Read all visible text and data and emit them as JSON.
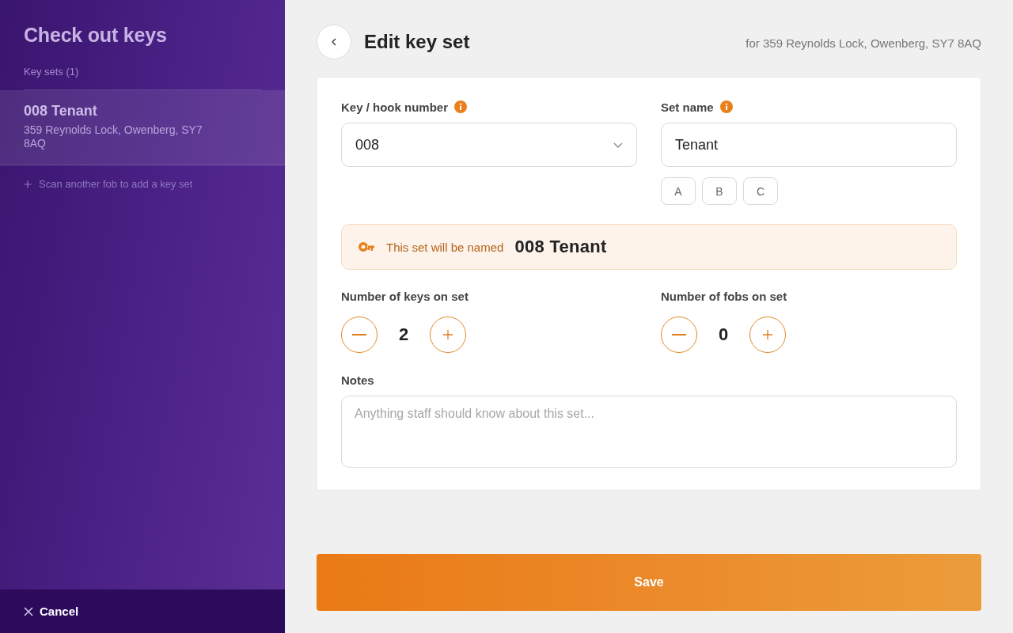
{
  "sidebar": {
    "title": "Check out keys",
    "section_label": "Key sets (1)",
    "key_sets": [
      {
        "name": "008 Tenant",
        "address": "359 Reynolds Lock, Owenberg, SY7 8AQ",
        "selected": true
      }
    ],
    "add_hint": "Scan another fob to add a key set",
    "cancel_button": "Cancel"
  },
  "header": {
    "title": "Edit key set",
    "subtitle": "for 359 Reynolds Lock, Owenberg, SY7 8AQ"
  },
  "form": {
    "hook_number": {
      "label": "Key / hook number",
      "value": "008"
    },
    "set_name": {
      "label": "Set name",
      "value": "Tenant",
      "suggestions": [
        "A",
        "B",
        "C"
      ]
    },
    "preview": {
      "label": "This set will be named",
      "value": "008 Tenant"
    },
    "counters": [
      {
        "label": "Number of keys on set",
        "value": "2"
      },
      {
        "label": "Number of fobs on set",
        "value": "0"
      }
    ],
    "notes": {
      "label": "Notes",
      "placeholder": "Anything staff should know about this set..."
    }
  },
  "save_button": "Save"
}
